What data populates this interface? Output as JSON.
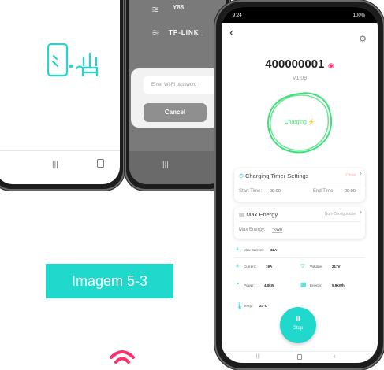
{
  "phone2": {
    "wifi_name": "TP-LINK_",
    "wifi_partial": "Y88",
    "password_placeholder": "Enter Wi-Fi password",
    "cancel_label": "Cancel"
  },
  "app": {
    "status_time": "9:24",
    "battery": "100%",
    "device_id": "400000001",
    "version": "V1.09",
    "charging_label": "Charging",
    "timer": {
      "title": "Charging Timer Settings",
      "state": "Close",
      "start_label": "Start Time:",
      "start_value": "00:00",
      "end_label": "End Time:",
      "end_value": "00:00"
    },
    "energy": {
      "title": "Max Energy",
      "state": "Non-Configurable",
      "label": "Max Energy:",
      "value": "*kWh"
    },
    "stats": {
      "max_current_label": "Max Current:",
      "max_current_value": "32A",
      "current_label": "Current:",
      "current_value": "19A",
      "voltage_label": "Voltage:",
      "voltage_value": "217V",
      "power_label": "Power:",
      "power_value": "4.0kW",
      "energy_label": "Energy:",
      "energy_value": "5.9kWh",
      "temp_label": "Temp:",
      "temp_value": "24°C"
    },
    "stop_label": "Stop"
  },
  "caption": "Imagem 5-3",
  "colors": {
    "accent": "#20d8cc",
    "green": "#3ee07a",
    "wifi_red": "#ff2d6b"
  }
}
